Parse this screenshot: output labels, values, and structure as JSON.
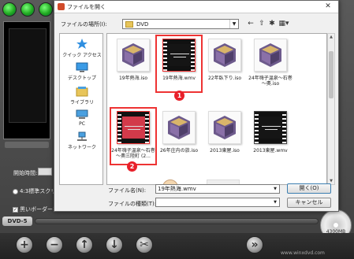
{
  "dialog": {
    "title": "ファイルを開く",
    "close_glyph": "✕",
    "look_in_label": "ファイルの場所(I):",
    "look_in_value": "DVD",
    "file_name_label": "ファイル名(N):",
    "file_name_value": "19年熱海.wmv",
    "file_type_label": "ファイルの種類(T):",
    "file_type_value": "",
    "open_button": "開く(O)",
    "cancel_button": "キャンセル"
  },
  "toolbar_icons": [
    "back-arrow-icon",
    "up-folder-icon",
    "new-folder-icon",
    "view-menu-icon"
  ],
  "places": [
    {
      "label": "クイック アクセス",
      "icon": "star-icon"
    },
    {
      "label": "デスクトップ",
      "icon": "desktop-icon"
    },
    {
      "label": "ライブラリ",
      "icon": "library-icon"
    },
    {
      "label": "PC",
      "icon": "pc-icon"
    },
    {
      "label": "ネットワーク",
      "icon": "network-icon"
    }
  ],
  "files": [
    {
      "name": "19年熱海.iso",
      "kind": "iso"
    },
    {
      "name": "19年熱海.wmv",
      "kind": "wmv",
      "selected": true
    },
    {
      "name": "22年臥下り.iso",
      "kind": "iso"
    },
    {
      "name": "24年嗨子温泉～石巻～奧.iso",
      "kind": "iso"
    },
    {
      "name": "24年嗨子温泉～石巻～奧三陸町 (2...",
      "kind": "wmv-red",
      "selected": true
    },
    {
      "name": "26年庄内の旅.iso",
      "kind": "iso"
    },
    {
      "name": "2013東屋.iso",
      "kind": "iso"
    },
    {
      "name": "2013東屋.wmv",
      "kind": "wmv"
    }
  ],
  "annotations": [
    "1",
    "2"
  ],
  "background_app": {
    "start_time_label": "開始時間:",
    "radio_label": "4:3標準スクリー",
    "checkbox_label": "黒いボーダーを",
    "dvd_badge": "DVD-5",
    "disc_label": "4300MB",
    "watermark": "www.winxdvd.com",
    "bottom_buttons": [
      "+",
      "−",
      "↑",
      "↓",
      "✂",
      "»"
    ]
  },
  "colors": {
    "selection_border": "#e33333",
    "annotation_red": "#e8202a",
    "folder_yellow": "#e8c55a"
  }
}
